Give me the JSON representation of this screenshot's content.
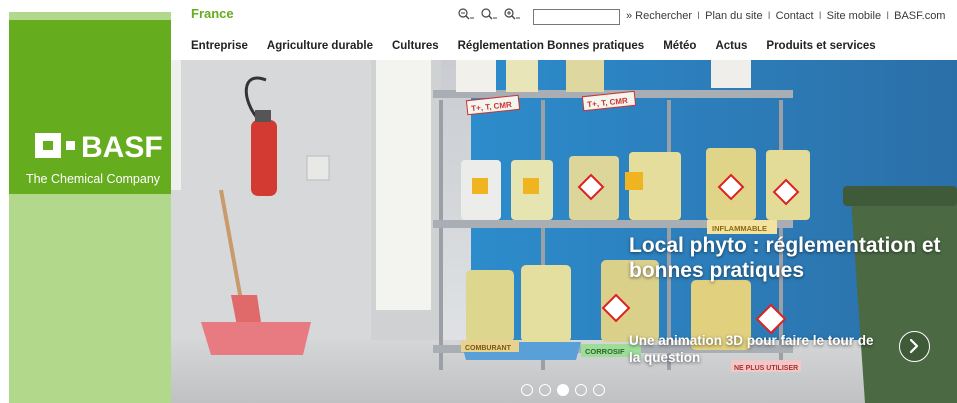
{
  "brand": {
    "logo_text": "BASF",
    "tagline": "The Chemical Company",
    "primary_color": "#65ac1e",
    "secondary_color": "#b2d88c"
  },
  "header": {
    "country": "France",
    "zoom_icons": [
      "zoom-out-icon",
      "zoom-reset-icon",
      "zoom-in-icon"
    ],
    "search": {
      "value": "",
      "button_label": "» Rechercher"
    },
    "utility_links": [
      "Plan du site",
      "Contact",
      "Site mobile",
      "BASF.com"
    ],
    "separator": "I"
  },
  "nav": {
    "items": [
      "Entreprise",
      "Agriculture durable",
      "Cultures",
      "Réglementation Bonnes pratiques",
      "Météo",
      "Actus",
      "Produits et services"
    ]
  },
  "hero": {
    "title": "Local phyto : réglementation et bonnes pratiques",
    "subtitle": "Une animation 3D pour faire le tour de la question",
    "slide_count": 5,
    "active_slide": 3,
    "labels": {
      "tag1": "T+, T, CMR",
      "tag2": "T+, T, CMR",
      "inflammable": "INFLAMMABLE",
      "corrosif": "CORROSIF",
      "comburant": "COMBURANT",
      "plus_utilise": "NE PLUS UTILISER"
    }
  }
}
